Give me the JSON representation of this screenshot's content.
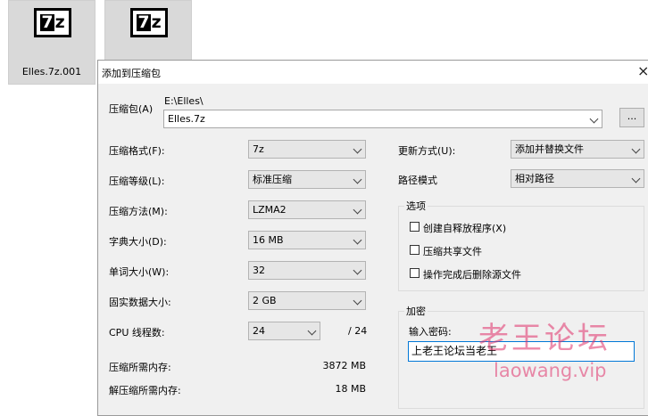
{
  "desktop": {
    "files": [
      {
        "name": "Elles.7z.001",
        "icon": "7z-archive-icon"
      },
      {
        "name": "",
        "icon": "7z-archive-icon"
      }
    ],
    "icon_glyph": {
      "seven": "7",
      "z": "z"
    }
  },
  "dialog": {
    "title": "添加到压缩包",
    "close_icon": "×",
    "archive": {
      "label": "压缩包(A)",
      "path": "E:\\Elles\\",
      "filename": "Elles.7z",
      "browse_label": "..."
    },
    "left": {
      "format": {
        "label": "压缩格式(F):",
        "value": "7z"
      },
      "level": {
        "label": "压缩等级(L):",
        "value": "标准压缩"
      },
      "method": {
        "label": "压缩方法(M):",
        "value": "LZMA2"
      },
      "dict": {
        "label": "字典大小(D):",
        "value": "16 MB"
      },
      "word": {
        "label": "单词大小(W):",
        "value": "32"
      },
      "solid": {
        "label": "固实数据大小:",
        "value": "2 GB"
      },
      "threads": {
        "label": "CPU 线程数:",
        "value": "24",
        "max": "/ 24"
      },
      "mem_compress": {
        "label": "压缩所需内存:",
        "value": "3872 MB"
      },
      "mem_decompress": {
        "label": "解压缩所需内存:",
        "value": "18 MB"
      }
    },
    "right": {
      "update": {
        "label": "更新方式(U):",
        "value": "添加并替换文件"
      },
      "path_mode": {
        "label": "路径模式",
        "value": "相对路径"
      },
      "options": {
        "title": "选项",
        "items": [
          "创建自释放程序(X)",
          "压缩共享文件",
          "操作完成后删除源文件"
        ]
      },
      "encryption": {
        "title": "加密",
        "password_label": "输入密码:",
        "password_value": "上老王论坛当老王"
      }
    }
  },
  "watermark": {
    "cn": "老王论坛",
    "url": "laowang.vip",
    "color": "#e0316a"
  }
}
